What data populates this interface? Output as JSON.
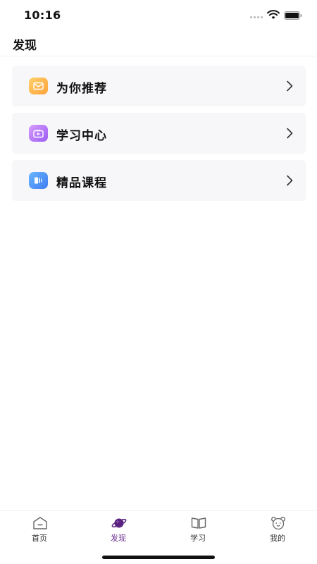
{
  "status_bar": {
    "time": "10:16"
  },
  "header": {
    "title": "发现"
  },
  "menu": {
    "items": [
      {
        "label": "为你推荐",
        "icon": "envelope-icon",
        "color": "#ffa33a"
      },
      {
        "label": "学习中心",
        "icon": "video-play-icon",
        "color": "#9a5cf3"
      },
      {
        "label": "精品课程",
        "icon": "book-icon",
        "color": "#3f7cf2"
      }
    ]
  },
  "tabbar": {
    "items": [
      {
        "label": "首页",
        "icon": "home-icon",
        "active": false
      },
      {
        "label": "发现",
        "icon": "planet-icon",
        "active": true
      },
      {
        "label": "学习",
        "icon": "open-book-icon",
        "active": false
      },
      {
        "label": "我的",
        "icon": "bear-face-icon",
        "active": false
      }
    ],
    "active_color": "#6c2c8e"
  }
}
